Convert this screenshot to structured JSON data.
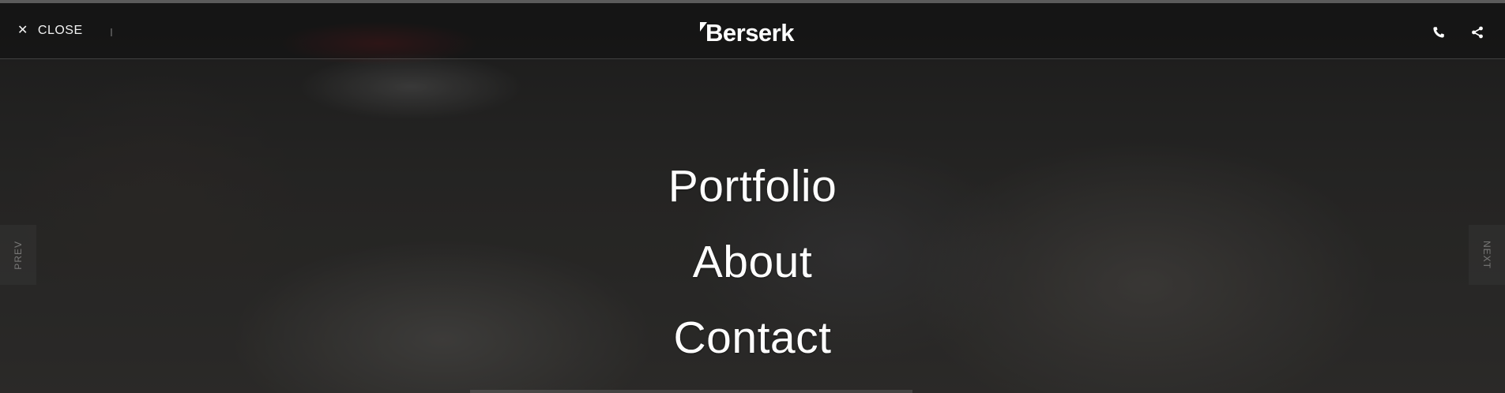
{
  "header": {
    "close_label": "CLOSE",
    "close_icon": "close-icon",
    "logo_text": "Berserk",
    "phone_icon": "phone-icon",
    "share_icon": "share-icon"
  },
  "navigation": {
    "prev_label": "PREV",
    "next_label": "NEXT"
  },
  "menu": {
    "items": [
      {
        "label": "Portfolio"
      },
      {
        "label": "About"
      },
      {
        "label": "Contact"
      }
    ]
  }
}
